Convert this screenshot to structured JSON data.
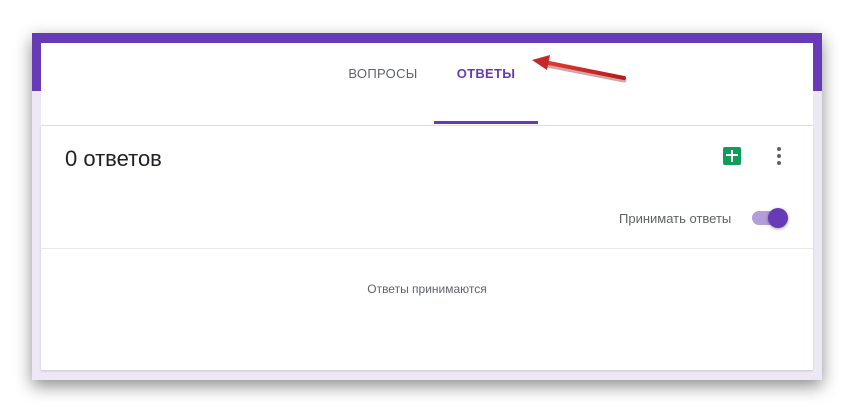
{
  "tabs": [
    {
      "label": "ВОПРОСЫ",
      "active": false
    },
    {
      "label": "ОТВЕТЫ",
      "active": true
    }
  ],
  "responses": {
    "count_title": "0 ответов",
    "accept_label": "Принимать ответы",
    "accepting": true,
    "status_text": "Ответы принимаются"
  },
  "icons": {
    "sheets": "google-sheets-icon",
    "more": "more-vertical-icon"
  },
  "colors": {
    "accent": "#673ab7",
    "background": "#ede7f6",
    "sheets_green": "#0f9d58",
    "annotation_arrow": "#c62828"
  }
}
